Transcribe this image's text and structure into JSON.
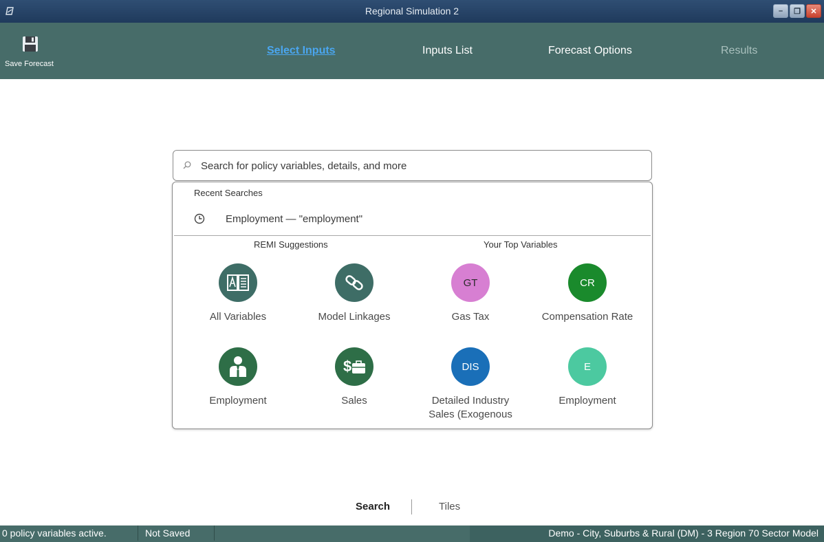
{
  "window": {
    "title": "Regional Simulation 2"
  },
  "toolbar": {
    "save_label": "Save Forecast",
    "tabs": [
      {
        "label": "Select Inputs",
        "state": "active"
      },
      {
        "label": "Inputs List",
        "state": "normal"
      },
      {
        "label": "Forecast Options",
        "state": "normal"
      },
      {
        "label": "Results",
        "state": "disabled"
      }
    ]
  },
  "search": {
    "placeholder": "Search for policy variables, details, and more",
    "value": ""
  },
  "dropdown": {
    "recent_title": "Recent Searches",
    "recent": [
      {
        "label": "Employment — \"employment\""
      }
    ],
    "suggestions_title": "REMI Suggestions",
    "top_title": "Your Top Variables",
    "tiles": [
      {
        "label": "All Variables",
        "icon": "book-icon",
        "color": "#3e6d66"
      },
      {
        "label": "Model Linkages",
        "icon": "chain-link-icon",
        "color": "#3e6d66"
      },
      {
        "label": "Gas Tax",
        "badge": "GT",
        "color": "#d77fd2"
      },
      {
        "label": "Compensation Rate",
        "badge": "CR",
        "color": "#1a8a2c"
      },
      {
        "label": "Employment",
        "icon": "worker-icon",
        "color": "#2e6e47"
      },
      {
        "label": "Sales",
        "icon": "money-briefcase-icon",
        "color": "#2e6e47"
      },
      {
        "label": "Detailed Industry Sales (Exogenous",
        "badge": "DIS",
        "color": "#1a6fb8"
      },
      {
        "label": "Employment",
        "badge": "E",
        "color": "#4cc9a0"
      }
    ]
  },
  "view_toggle": {
    "search": "Search",
    "tiles": "Tiles"
  },
  "status": {
    "active": "0 policy variables active.",
    "saved": "Not Saved",
    "model": "Demo - City, Suburbs & Rural (DM) -  3 Region 70 Sector Model"
  },
  "colors": {
    "toolbar": "#476c69",
    "accent": "#4aa6f0",
    "titlebar": "#2f4e73"
  }
}
